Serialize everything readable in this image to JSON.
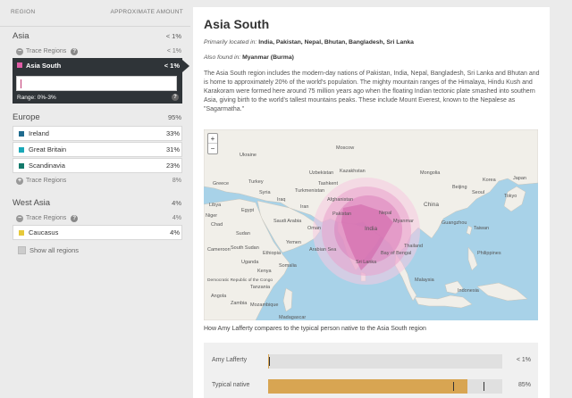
{
  "left": {
    "header": {
      "region_label": "REGION",
      "amount_label": "APPROXIMATE AMOUNT"
    },
    "asia": {
      "title": "Asia",
      "pct": "< 1%",
      "trace": {
        "label": "Trace Regions",
        "pct": "< 1%"
      },
      "selected": {
        "label": "Asia South",
        "pct": "< 1%",
        "range": "Range: 0%-3%",
        "color": "#e05ca6"
      }
    },
    "europe": {
      "title": "Europe",
      "pct": "95%",
      "items": [
        {
          "label": "Ireland",
          "pct": "33%",
          "color": "#1f6b8e"
        },
        {
          "label": "Great Britain",
          "pct": "31%",
          "color": "#1aa8b8"
        },
        {
          "label": "Scandinavia",
          "pct": "23%",
          "color": "#137a6b"
        }
      ],
      "trace": {
        "label": "Trace Regions",
        "pct": "8%"
      }
    },
    "west_asia": {
      "title": "West Asia",
      "pct": "4%",
      "trace": {
        "label": "Trace Regions",
        "pct": "4%"
      },
      "items": [
        {
          "label": "Caucasus",
          "pct": "4%",
          "color": "#e6c93a"
        }
      ]
    },
    "show_all": "Show all regions"
  },
  "detail": {
    "title": "Asia South",
    "primarily_label": "Primarily located in:",
    "primarily_value": "India, Pakistan, Nepal, Bhutan, Bangladesh, Sri Lanka",
    "also_label": "Also found in:",
    "also_value": "Myanmar (Burma)",
    "description": "The Asia South region includes the modern-day nations of Pakistan, India, Nepal, Bangladesh, Sri Lanka and Bhutan and is home to approximately 20% of the world's population. The mighty mountain ranges of the Himalaya, Hindu Kush and Karakoram were formed here around 75 million years ago when the floating Indian tectonic plate smashed into southern Asia, giving birth to the world's tallest mountains peaks. These include Mount Everest, known to the Nepalese as \"Sagarmatha.\"",
    "map": {
      "zoom_in": "+",
      "zoom_out": "−",
      "labels": {
        "moscow": "Moscow",
        "kazakhstan": "Kazakhstan",
        "mongolia": "Mongolia",
        "beijing": "Beijing",
        "korea": "Korea",
        "japan": "Japan",
        "tokyo": "Tokyo",
        "seoul": "Seoul",
        "china": "China",
        "afghanistan": "Afghanistan",
        "pakistan": "Pakistan",
        "nepal": "Nepal",
        "india": "India",
        "iran": "Iran",
        "iraq": "Iraq",
        "syria": "Syria",
        "turkey": "Turkey",
        "greece": "Greece",
        "libya": "Libya",
        "egypt": "Egypt",
        "saudi_arabia": "Saudi Arabia",
        "oman": "Oman",
        "yemen": "Yemen",
        "sudan": "Sudan",
        "ethiopia": "Ethiopia",
        "kenya": "Kenya",
        "tanzania": "Tanzania",
        "drc": "Democratic Republic of the Congo",
        "mozambique": "Mozambique",
        "madagascar": "Madagascar",
        "sri_lanka": "Sri Lanka",
        "thailand": "Thailand",
        "myanmar": "Myanmar",
        "malaysia": "Malaysia",
        "indonesia": "Indonesia",
        "philippines": "Philippines",
        "taiwan": "Taiwan",
        "guangzhou": "Guangzhou",
        "bay_of_bengal": "Bay of Bengal",
        "arabian_sea": "Arabian Sea",
        "tashkent": "Tashkent",
        "ukraine": "Ukraine",
        "chad": "Chad",
        "niger": "Niger",
        "cameroon": "Cameroon",
        "south_sudan": "South Sudan",
        "somalia": "Somalia",
        "uganda": "Uganda",
        "angola": "Angola",
        "zambia": "Zambia",
        "uzbekistan": "Uzbekistan",
        "turkmenistan": "Turkmenistan"
      }
    }
  },
  "comparison": {
    "title": "How Amy Lafferty compares to the typical person native to the Asia South region",
    "rows": [
      {
        "name": "Amy Lafferty",
        "value": "< 1%",
        "fill": 0.005
      },
      {
        "name": "Typical native",
        "value": "85%",
        "fill": 0.85,
        "range": [
          0.79,
          0.92
        ]
      }
    ],
    "bar_color": "#d8a552"
  }
}
